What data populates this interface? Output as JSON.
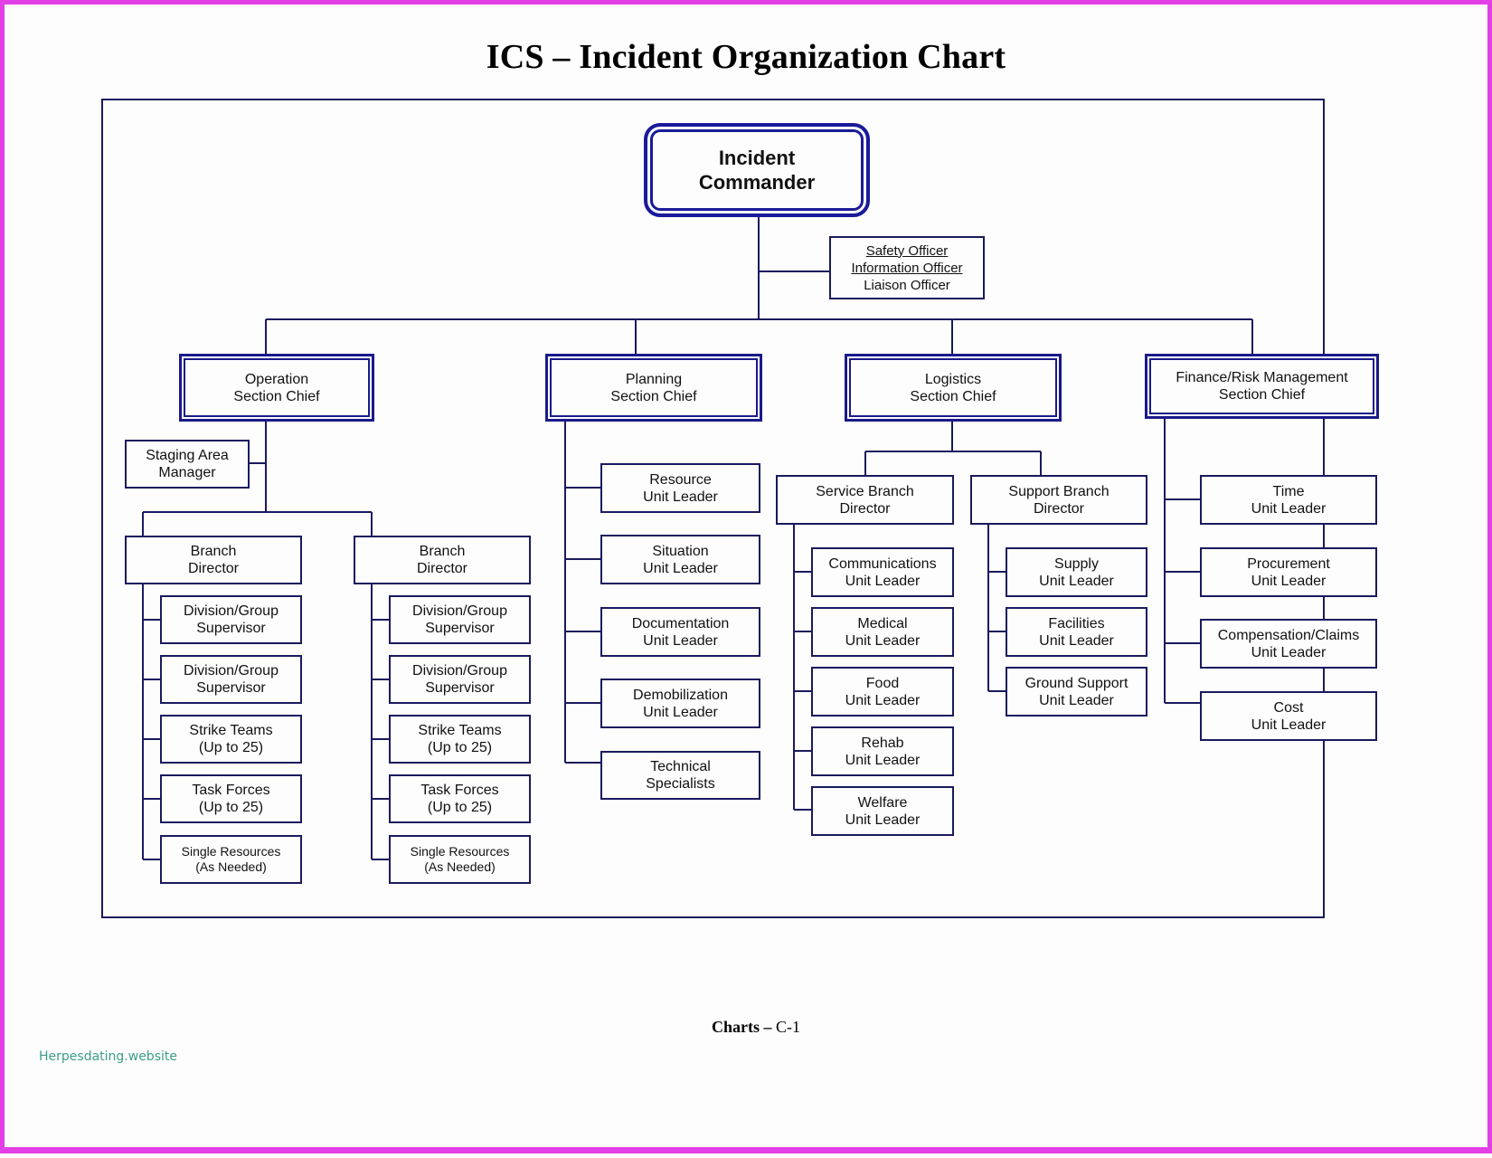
{
  "title": "ICS – Incident Organization Chart",
  "footer": {
    "bold": "Charts –",
    "page": "C-1"
  },
  "watermark": "Herpesdating.website",
  "colors": {
    "line": "#1a1a5e",
    "accent": "#1a1a8a",
    "page_border": "#e33fe6",
    "watermark": "#3b9e86"
  },
  "commander": "Incident\nCommander",
  "command_staff": [
    "Safety Officer",
    "Information Officer",
    "Liaison Officer"
  ],
  "sections": {
    "operations": {
      "label": "Operation\nSection Chief",
      "staging": "Staging Area\nManager",
      "branches": [
        {
          "label": "Branch\nDirector",
          "children": [
            "Division/Group\nSupervisor",
            "Division/Group\nSupervisor",
            "Strike Teams\n(Up to 25)",
            "Task Forces\n(Up to 25)",
            "Single Resources\n(As Needed)"
          ]
        },
        {
          "label": "Branch\nDirector",
          "children": [
            "Division/Group\nSupervisor",
            "Division/Group\nSupervisor",
            "Strike Teams\n(Up to 25)",
            "Task Forces\n(Up to 25)",
            "Single Resources\n(As Needed)"
          ]
        }
      ]
    },
    "planning": {
      "label": "Planning\nSection Chief",
      "children": [
        "Resource\nUnit Leader",
        "Situation\nUnit Leader",
        "Documentation\nUnit Leader",
        "Demobilization\nUnit Leader",
        "Technical\nSpecialists"
      ]
    },
    "logistics": {
      "label": "Logistics\nSection Chief",
      "branches": [
        {
          "label": "Service Branch\nDirector",
          "children": [
            "Communications\nUnit Leader",
            "Medical\nUnit Leader",
            "Food\nUnit Leader",
            "Rehab\nUnit Leader",
            "Welfare\nUnit Leader"
          ]
        },
        {
          "label": "Support Branch\nDirector",
          "children": [
            "Supply\nUnit Leader",
            "Facilities\nUnit Leader",
            "Ground Support\nUnit Leader"
          ]
        }
      ]
    },
    "finance": {
      "label": "Finance/Risk Management\nSection Chief",
      "children": [
        "Time\nUnit Leader",
        "Procurement\nUnit Leader",
        "Compensation/Claims\nUnit Leader",
        "Cost\nUnit Leader"
      ]
    }
  }
}
